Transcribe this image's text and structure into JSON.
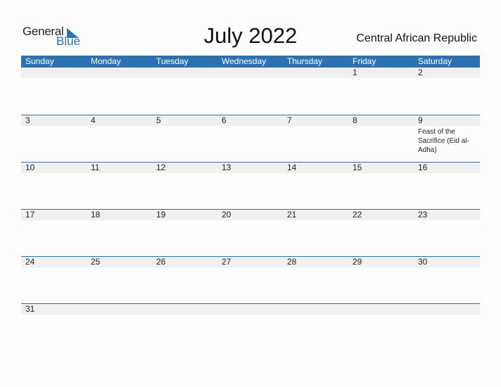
{
  "logo": {
    "general": "General",
    "blue": "Blue"
  },
  "header": {
    "title": "July 2022",
    "country": "Central African Republic"
  },
  "colors": {
    "accent": "#2e71b1",
    "band": "#f0f0f0"
  },
  "weekdays": [
    "Sunday",
    "Monday",
    "Tuesday",
    "Wednesday",
    "Thursday",
    "Friday",
    "Saturday"
  ],
  "weeks": [
    {
      "days": [
        "",
        "",
        "",
        "",
        "",
        "1",
        "2"
      ],
      "events": [
        "",
        "",
        "",
        "",
        "",
        "",
        ""
      ]
    },
    {
      "days": [
        "3",
        "4",
        "5",
        "6",
        "7",
        "8",
        "9"
      ],
      "events": [
        "",
        "",
        "",
        "",
        "",
        "",
        "Feast of the Sacrifice (Eid al-Adha)"
      ]
    },
    {
      "days": [
        "10",
        "11",
        "12",
        "13",
        "14",
        "15",
        "16"
      ],
      "events": [
        "",
        "",
        "",
        "",
        "",
        "",
        ""
      ]
    },
    {
      "days": [
        "17",
        "18",
        "19",
        "20",
        "21",
        "22",
        "23"
      ],
      "events": [
        "",
        "",
        "",
        "",
        "",
        "",
        ""
      ]
    },
    {
      "days": [
        "24",
        "25",
        "26",
        "27",
        "28",
        "29",
        "30"
      ],
      "events": [
        "",
        "",
        "",
        "",
        "",
        "",
        ""
      ]
    },
    {
      "days": [
        "31",
        "",
        "",
        "",
        "",
        "",
        ""
      ],
      "events": [
        "",
        "",
        "",
        "",
        "",
        "",
        ""
      ]
    }
  ]
}
